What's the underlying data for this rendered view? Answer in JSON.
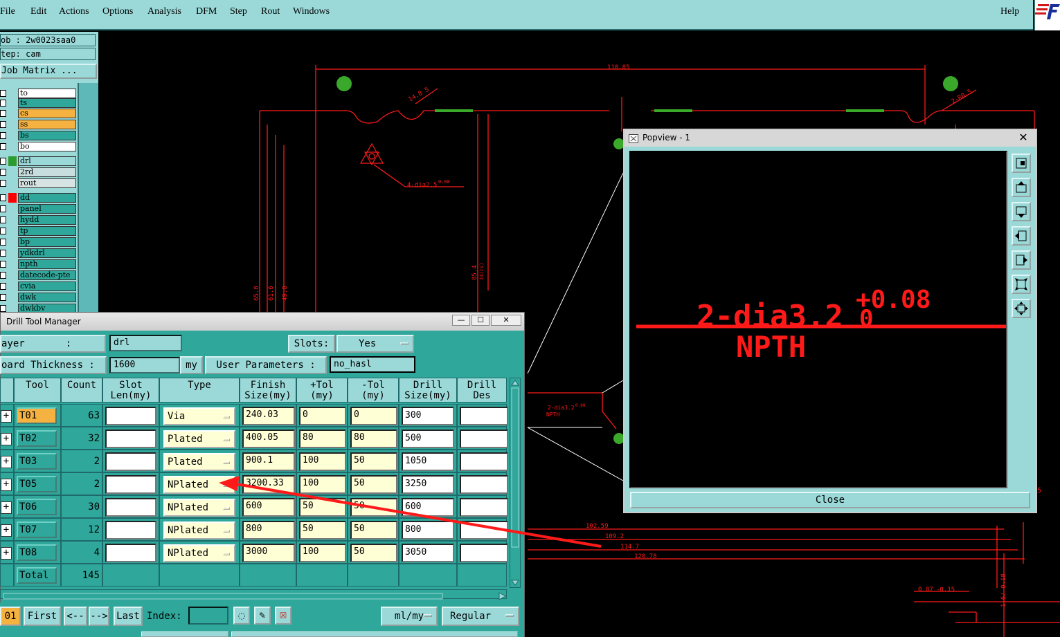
{
  "menubar": {
    "items": [
      "File",
      "Edit",
      "Actions",
      "Options",
      "Analysis",
      "DFM",
      "Step",
      "Rout",
      "Windows"
    ],
    "help": "Help"
  },
  "job_panel": {
    "job_line": "ob : 2w0023saa0",
    "step_line": "tep: cam",
    "job_matrix": "Job Matrix ..."
  },
  "layers": [
    {
      "name": "to",
      "bg": "#ffffff",
      "dot": ""
    },
    {
      "name": "ts",
      "bg": "#2fa79a",
      "dot": ""
    },
    {
      "name": "cs",
      "bg": "#f5b241",
      "dot": ""
    },
    {
      "name": "ss",
      "bg": "#f5b241",
      "dot": ""
    },
    {
      "name": "bs",
      "bg": "#2fa79a",
      "dot": ""
    },
    {
      "name": "bo",
      "bg": "#ffffff",
      "dot": ""
    },
    {
      "name": "drl",
      "bg": "#9bd9d9",
      "dot": "#2e9b2e"
    },
    {
      "name": "2rd",
      "bg": "#c8dede",
      "dot": ""
    },
    {
      "name": "rout",
      "bg": "#d7e3e3",
      "dot": ""
    },
    {
      "name": "dd",
      "bg": "#2fa79a",
      "dot": "#ff0000"
    },
    {
      "name": "panel",
      "bg": "#2fa79a",
      "dot": ""
    },
    {
      "name": "hydd",
      "bg": "#2fa79a",
      "dot": ""
    },
    {
      "name": "tp",
      "bg": "#2fa79a",
      "dot": ""
    },
    {
      "name": "bp",
      "bg": "#2fa79a",
      "dot": ""
    },
    {
      "name": "ydkdrl",
      "bg": "#2fa79a",
      "dot": ""
    },
    {
      "name": "npth",
      "bg": "#2fa79a",
      "dot": ""
    },
    {
      "name": "datecode-pte",
      "bg": "#2fa79a",
      "dot": ""
    },
    {
      "name": "cvia",
      "bg": "#2fa79a",
      "dot": ""
    },
    {
      "name": "dwk",
      "bg": "#2fa79a",
      "dot": ""
    },
    {
      "name": "dwkbv",
      "bg": "#2fa79a",
      "dot": ""
    }
  ],
  "cad": {
    "dim_top": "110.85",
    "callout_1": "14.8 5",
    "callout_2": "2-R0.5",
    "note_small": "4-dia2.5",
    "note_small_tol": "0.08",
    "dims_left": [
      "65.8",
      "61.6",
      "49.8"
    ],
    "dim_mid": "85.4",
    "dim_mid2": "24(cs)",
    "dims_bottom": [
      "102.59",
      "109.2",
      "114.7",
      "120.78"
    ],
    "dim_right_small": "0.87",
    "dim_right_tol": "-0.15",
    "dim_right_vertical": "1.6/-0.18",
    "zoom_note": "2-dia3.2",
    "zoom_note_tol": "0.08",
    "zoom_sub": "NPTH",
    "edge_mark": "5"
  },
  "popview": {
    "title": "Popview - 1",
    "close_x": "✕",
    "zoom_text": "2-dia3.2",
    "zoom_superscript": "+0.08",
    "zoom_sub_zero": "0",
    "zoom_sub": "NPTH",
    "close_label": "Close"
  },
  "dtm": {
    "title": "Drill Tool Manager",
    "btn_min": "—",
    "btn_max": "☐",
    "btn_close": "✕",
    "layer_label": "ayer       :",
    "layer_value": "drl",
    "slots_label": "Slots:",
    "slots_value": "Yes",
    "thickness_label": "oard Thickness :",
    "thickness_value": "1600",
    "thickness_unit": "my",
    "user_params_label": "User Parameters :",
    "user_params_value": "no_hasl",
    "columns": [
      "Tool",
      "Count",
      "Slot\nLen(my)",
      "Type",
      "Finish\nSize(my)",
      "+Tol\n(my)",
      "-Tol\n(my)",
      "Drill\nSize(my)",
      "Drill\nDes"
    ],
    "rows": [
      {
        "tool": "T01",
        "count": "63",
        "type": "Via",
        "finish": "240.03",
        "ptol": "0",
        "mtol": "0",
        "drill": "300"
      },
      {
        "tool": "T02",
        "count": "32",
        "type": "Plated",
        "finish": "400.05",
        "ptol": "80",
        "mtol": "80",
        "drill": "500"
      },
      {
        "tool": "T03",
        "count": "2",
        "type": "Plated",
        "finish": "900.1",
        "ptol": "100",
        "mtol": "50",
        "drill": "1050"
      },
      {
        "tool": "T05",
        "count": "2",
        "type": "NPlated",
        "finish": "3200.33",
        "ptol": "100",
        "mtol": "50",
        "drill": "3250"
      },
      {
        "tool": "T06",
        "count": "30",
        "type": "NPlated",
        "finish": "600",
        "ptol": "50",
        "mtol": "50",
        "drill": "600"
      },
      {
        "tool": "T07",
        "count": "12",
        "type": "NPlated",
        "finish": "800",
        "ptol": "50",
        "mtol": "50",
        "drill": "800"
      },
      {
        "tool": "T08",
        "count": "4",
        "type": "NPlated",
        "finish": "3000",
        "ptol": "100",
        "mtol": "50",
        "drill": "3050"
      }
    ],
    "total_label": "Total",
    "total_count": "145",
    "toolbar": {
      "current": "01",
      "first": "First",
      "prev": "<--",
      "next": "-->",
      "last": "Last",
      "index_label": "Index:",
      "units": "ml/my",
      "mode": "Regular"
    }
  },
  "colors": {
    "panel": "#9bd9d9",
    "dialog": "#2fa79a",
    "cad_red": "#ff1a1a",
    "pad_green": "#3aa82a",
    "highlight": "#f5b241"
  }
}
